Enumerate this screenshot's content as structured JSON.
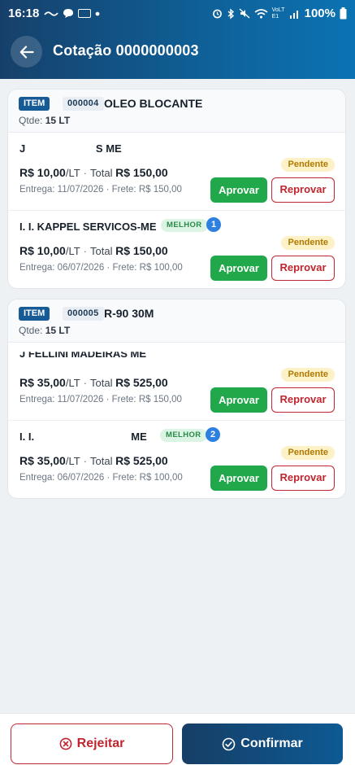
{
  "status_bar": {
    "time": "16:18",
    "battery_percent": "100%",
    "network_label": "VoLTE1",
    "icons": [
      "wave-icon",
      "chat-icon",
      "gallery-icon",
      "dot-icon",
      "alarm-icon",
      "bluetooth-icon",
      "mute-icon",
      "wifi-icon",
      "signal-icon",
      "battery-icon"
    ]
  },
  "header": {
    "title": "Cotação 0000000003",
    "back_icon": "arrow-left-icon",
    "gradient": [
      "#16406a",
      "#0b73b3"
    ]
  },
  "colors": {
    "approve": "#21a84a",
    "reject": "#c0262f",
    "pending_bg": "#fdf1c8",
    "pending_text": "#b07a00",
    "best_bg": "#dcf4e3",
    "rank_badge": "#2d7fe0"
  },
  "items": [
    {
      "tag": "ITEM",
      "code": "000004",
      "name": "OLEO BLOCANTE",
      "qty_label": "Qtde:",
      "qty_value": "15 LT",
      "offers": [
        {
          "supplier": "J                        S ME",
          "best_label": "",
          "rank": "",
          "unit_price": "R$ 10,00",
          "unit": "/LT",
          "dot": "·",
          "total_label": "Total",
          "total": "R$ 150,00",
          "delivery": "Entrega: 11/07/2026 · Frete: R$ 150,00",
          "status": "Pendente",
          "approve_label": "Aprovar",
          "reject_label": "Reprovar"
        },
        {
          "supplier": "I. I. KAPPEL SERVICOS-ME",
          "best_label": "MELHOR",
          "rank": "1",
          "unit_price": "R$ 10,00",
          "unit": "/LT",
          "dot": "·",
          "total_label": "Total",
          "total": "R$ 150,00",
          "delivery": "Entrega: 06/07/2026 · Frete: R$ 100,00",
          "status": "Pendente",
          "approve_label": "Aprovar",
          "reject_label": "Reprovar"
        }
      ]
    },
    {
      "tag": "ITEM",
      "code": "000005",
      "name": "R-90 30M",
      "qty_label": "Qtde:",
      "qty_value": "15 LT",
      "offers": [
        {
          "supplier": "J FELLINI MADEIRAS ME",
          "best_label": "",
          "rank": "",
          "unit_price": "R$ 35,00",
          "unit": "/LT",
          "dot": "·",
          "total_label": "Total",
          "total": "R$ 525,00",
          "delivery": "Entrega: 11/07/2026 · Frete: R$ 150,00",
          "status": "Pendente",
          "approve_label": "Aprovar",
          "reject_label": "Reprovar"
        },
        {
          "supplier": "I. I.                                 ME",
          "best_label": "MELHOR",
          "rank": "2",
          "unit_price": "R$ 35,00",
          "unit": "/LT",
          "dot": "·",
          "total_label": "Total",
          "total": "R$ 525,00",
          "delivery": "Entrega: 06/07/2026 · Frete: R$ 100,00",
          "status": "Pendente",
          "approve_label": "Aprovar",
          "reject_label": "Reprovar"
        }
      ]
    }
  ],
  "footer": {
    "reject_label": "Rejeitar",
    "reject_icon": "x-circle-icon",
    "confirm_label": "Confirmar",
    "confirm_icon": "check-circle-icon"
  }
}
